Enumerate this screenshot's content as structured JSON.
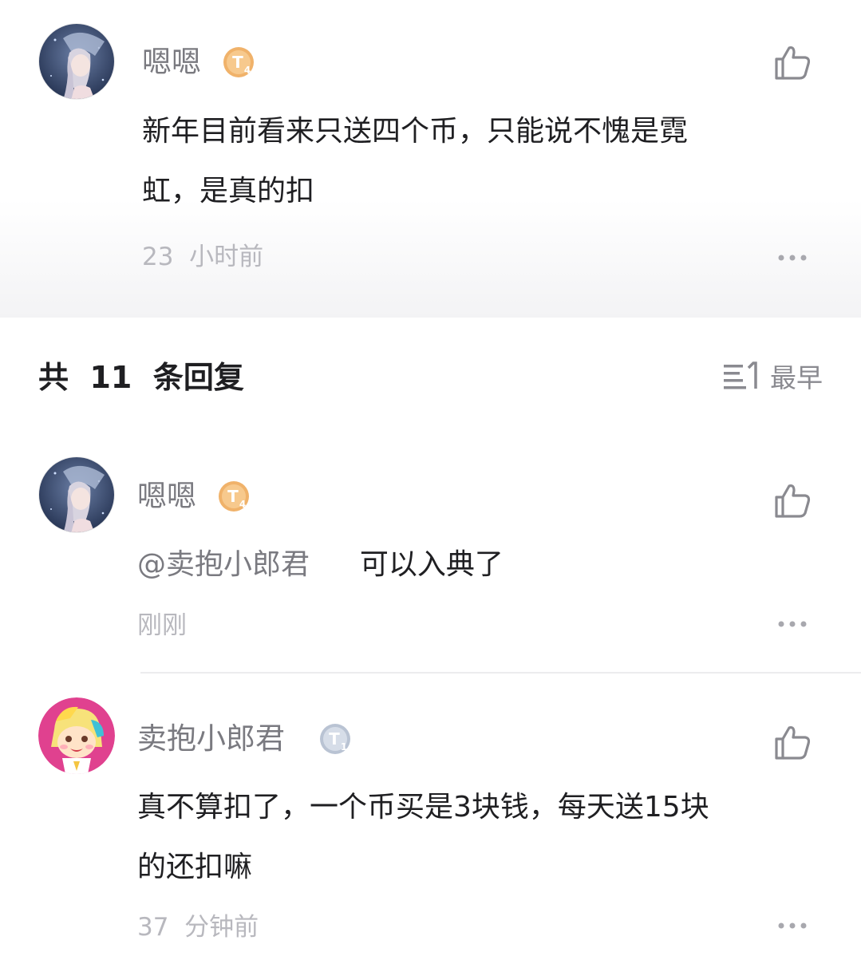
{
  "main_comment": {
    "username": "嗯嗯",
    "level_badge": "T4",
    "avatar_icon": "anime-girl-umbrella-avatar",
    "content_lines": [
      "新年目前看来只送四个币，只能说不愧是霓",
      "虹，是真的扣"
    ],
    "time_number": "23",
    "time_unit": "小时前"
  },
  "replies_header": {
    "prefix": "共",
    "count": "11",
    "suffix": "条回复",
    "sort_label": "最早",
    "sort_icon": "sort-list-icon"
  },
  "replies": [
    {
      "username": "嗯嗯",
      "level_badge": "T4",
      "avatar_icon": "anime-girl-umbrella-avatar",
      "mention": "@卖抱小郎君",
      "content": "可以入典了",
      "time": "刚刚"
    },
    {
      "username": "卖抱小郎君",
      "level_badge": "T1",
      "avatar_icon": "cartoon-character-avatar",
      "content_lines": [
        "真不算扣了，一个币买是3块钱，每天送15块",
        "的还扣嘛"
      ],
      "time_number": "37",
      "time_unit": "分钟前"
    }
  ],
  "colors": {
    "badge_gold": "#f0b26a",
    "badge_silver": "#b9c3d3",
    "text_primary": "#1f1f22",
    "text_secondary": "#7a7a80",
    "text_meta": "#b8b8be"
  }
}
